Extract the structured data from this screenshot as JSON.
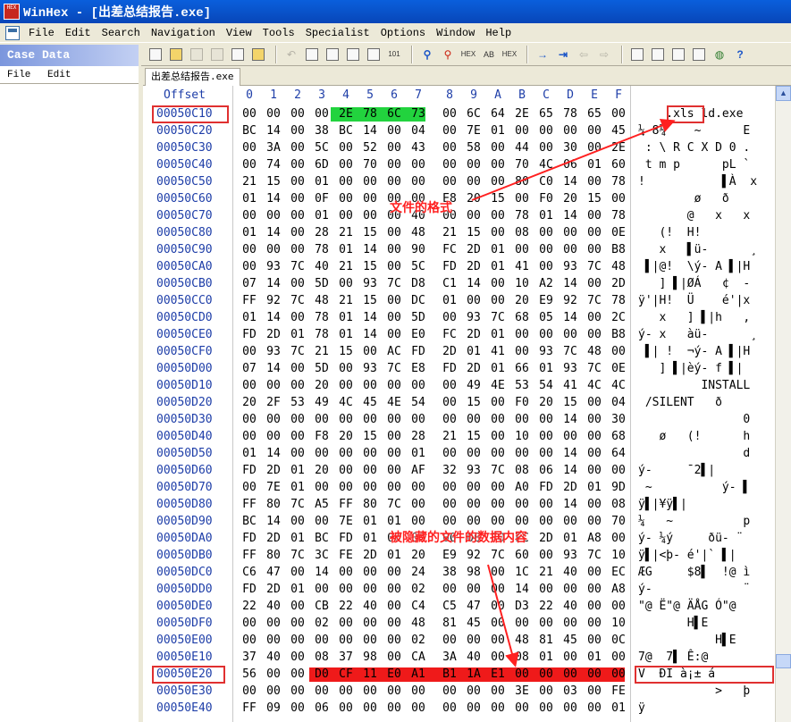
{
  "window": {
    "title": "WinHex - [出差总结报告.exe]",
    "app_icon_text": "HEX"
  },
  "menu": [
    "File",
    "Edit",
    "Search",
    "Navigation",
    "View",
    "Tools",
    "Specialist",
    "Options",
    "Window",
    "Help"
  ],
  "case_panel": {
    "title": "Case Data",
    "menu": [
      "File",
      "Edit"
    ]
  },
  "tab": {
    "label": "出差总结报告.exe"
  },
  "hex": {
    "offset_header": "Offset",
    "columns": [
      "0",
      "1",
      "2",
      "3",
      "4",
      "5",
      "6",
      "7",
      "8",
      "9",
      "A",
      "B",
      "C",
      "D",
      "E",
      "F"
    ],
    "rows": [
      {
        "off": "00050C10",
        "bytes": "00 00 00 00 2E 78 6C 73 00 6C 64 2E 65 78 65 00",
        "ascii": "    .xls ld.exe"
      },
      {
        "off": "00050C20",
        "bytes": "BC 14 00 38 BC 14 00 04 00 7E 01 00 00 00 00 45",
        "ascii": "¼ 8¼    ~      E"
      },
      {
        "off": "00050C30",
        "bytes": "00 3A 00 5C 00 52 00 43 00 58 00 44 00 30 00 2E",
        "ascii": " : \\ R C X D 0 ."
      },
      {
        "off": "00050C40",
        "bytes": "00 74 00 6D 00 70 00 00 00 00 00 70 4C 06 01 60",
        "ascii": " t m p      pL `"
      },
      {
        "off": "00050C50",
        "bytes": "21 15 00 01 00 00 00 00 00 00 00 80 C0 14 00 78",
        "ascii": "!           ▌À  x"
      },
      {
        "off": "00050C60",
        "bytes": "01 14 00 0F 00 00 00 00 E8 20 15 00 F0 20 15 00",
        "ascii": "        ø   ð"
      },
      {
        "off": "00050C70",
        "bytes": "00 00 00 01 00 00 00 40 00 00 00 78 01 14 00 78",
        "ascii": "       @   x   x"
      },
      {
        "off": "00050C80",
        "bytes": "01 14 00 28 21 15 00 48 21 15 00 08 00 00 00 0E",
        "ascii": "   (!  H!"
      },
      {
        "off": "00050C90",
        "bytes": "00 00 00 78 01 14 00 90 FC 2D 01 00 00 00 00 B8",
        "ascii": "   x   ▌ü-      ¸"
      },
      {
        "off": "00050CA0",
        "bytes": "00 93 7C 40 21 15 00 5C FD 2D 01 41 00 93 7C 48",
        "ascii": " ▌|@!  \\ý- A ▌|H"
      },
      {
        "off": "00050CB0",
        "bytes": "07 14 00 5D 00 93 7C D8 C1 14 00 10 A2 14 00 2D",
        "ascii": "   ] ▌|ØÁ   ¢  -"
      },
      {
        "off": "00050CC0",
        "bytes": "FF 92 7C 48 21 15 00 DC 01 00 00 20 E9 92 7C 78",
        "ascii": "ÿ'|H!  Ü    é'|x"
      },
      {
        "off": "00050CD0",
        "bytes": "01 14 00 78 01 14 00 5D 00 93 7C 68 05 14 00 2C",
        "ascii": "   x   ] ▌|h   ,"
      },
      {
        "off": "00050CE0",
        "bytes": "FD 2D 01 78 01 14 00 E0 FC 2D 01 00 00 00 00 B8",
        "ascii": "ý- x   àü-      ¸"
      },
      {
        "off": "00050CF0",
        "bytes": "00 93 7C 21 15 00 AC FD 2D 01 41 00 93 7C 48 00",
        "ascii": " ▌| !  ¬ý- A ▌|H"
      },
      {
        "off": "00050D00",
        "bytes": "07 14 00 5D 00 93 7C E8 FD 2D 01 66 01 93 7C 0E",
        "ascii": "   ] ▌|èý- f ▌|"
      },
      {
        "off": "00050D10",
        "bytes": "00 00 00 20 00 00 00 00 00 49 4E 53 54 41 4C 4C",
        "ascii": "         INSTALL"
      },
      {
        "off": "00050D20",
        "bytes": "20 2F 53 49 4C 45 4E 54 00 15 00 F0 20 15 00 04",
        "ascii": " /SILENT   ð"
      },
      {
        "off": "00050D30",
        "bytes": "00 00 00 00 00 00 00 00 00 00 00 00 00 14 00 30",
        "ascii": "               0"
      },
      {
        "off": "00050D40",
        "bytes": "00 00 00 F8 20 15 00 28 21 15 00 10 00 00 00 68",
        "ascii": "   ø   (!      h"
      },
      {
        "off": "00050D50",
        "bytes": "01 14 00 00 00 00 00 01 00 00 00 00 00 14 00 64",
        "ascii": "               d"
      },
      {
        "off": "00050D60",
        "bytes": "FD 2D 01 20 00 00 00 AF 32 93 7C 08 06 14 00 00",
        "ascii": "ý-     ¯2▌|"
      },
      {
        "off": "00050D70",
        "bytes": "00 7E 01 00 00 00 00 00 00 00 00 A0 FD 2D 01 9D",
        "ascii": " ~          ý- ▌"
      },
      {
        "off": "00050D80",
        "bytes": "FF 80 7C A5 FF 80 7C 00 00 00 00 00 00 14 00 08",
        "ascii": "ÿ▌|¥ÿ▌|"
      },
      {
        "off": "00050D90",
        "bytes": "BC 14 00 00 7E 01 01 00 00 00 00 00 00 00 00 70",
        "ascii": "¼   ~          p"
      },
      {
        "off": "00050DA0",
        "bytes": "FD 2D 01 BC FD 01 00 00 00 00 F0 FC 2D 01 A8 00",
        "ascii": "ý- ¼ý     ðü- ¨"
      },
      {
        "off": "00050DB0",
        "bytes": "FF 80 7C 3C FE 2D 01 20 E9 92 7C 60 00 93 7C 10",
        "ascii": "ÿ▌|<þ- é'|` ▌|"
      },
      {
        "off": "00050DC0",
        "bytes": "C6 47 00 14 00 00 00 24 38 98 00 1C 21 40 00 EC",
        "ascii": "ÆG     $8▌  !@ ì"
      },
      {
        "off": "00050DD0",
        "bytes": "FD 2D 01 00 00 00 00 02 00 00 00 14 00 00 00 A8",
        "ascii": "ý-             ¨"
      },
      {
        "off": "00050DE0",
        "bytes": "22 40 00 CB 22 40 00 C4 C5 47 00 D3 22 40 00 00",
        "ascii": "\"@ Ë\"@ ÄÅG Ó\"@"
      },
      {
        "off": "00050DF0",
        "bytes": "00 00 00 02 00 00 00 48 81 45 00 00 00 00 00 10",
        "ascii": "       H▌E"
      },
      {
        "off": "00050E00",
        "bytes": "00 00 00 00 00 00 00 02 00 00 00 48 81 45 00 0C",
        "ascii": "           H▌E"
      },
      {
        "off": "00050E10",
        "bytes": "37 40 00 08 37 98 00 CA 3A 40 00 08 01 00 01 00",
        "ascii": "7@  7▌ Ê:@"
      },
      {
        "off": "00050E20",
        "bytes": "56 00 00 D0 CF 11 E0 A1 B1 1A E1 00 00 00 00 00",
        "ascii": "V  ÐÏ à¡± á"
      },
      {
        "off": "00050E30",
        "bytes": "00 00 00 00 00 00 00 00 00 00 00 3E 00 03 00 FE",
        "ascii": "           >   þ"
      },
      {
        "off": "00050E40",
        "bytes": "FF 09 00 06 00 00 00 00 00 00 00 00 00 00 00 01",
        "ascii": "ÿ"
      }
    ]
  },
  "annotations": {
    "format": "文件的格式",
    "hidden": "被隐藏的文件的数据内容"
  },
  "colors": {
    "green_highlight": "#22d33e",
    "red_highlight": "#ef1a1a",
    "offset_blue": "#1e3ea8"
  }
}
